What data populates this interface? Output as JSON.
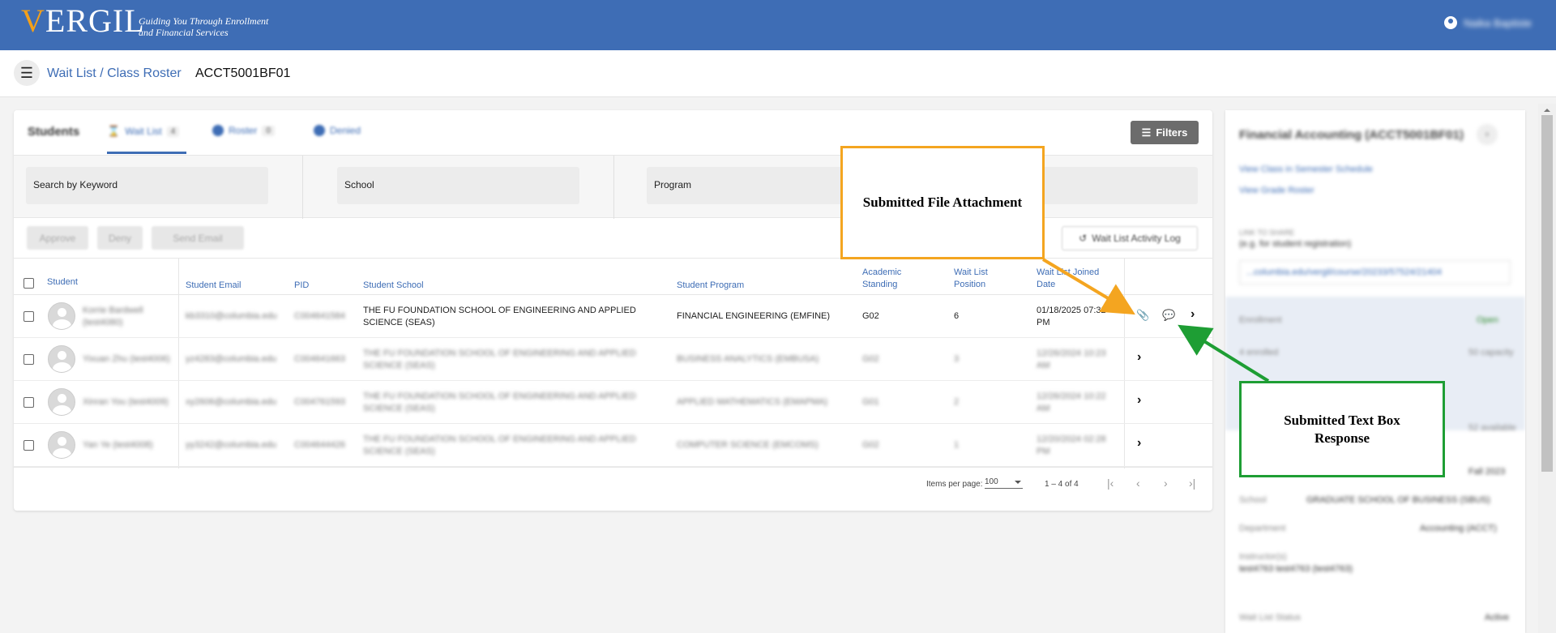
{
  "header": {
    "logo_text": "VERGIL",
    "tagline_line1": "Guiding You Through Enrollment",
    "tagline_line2": "and Financial Services",
    "user_name": "Naika Baptiste"
  },
  "breadcrumb": {
    "path": "Wait List / Class Roster",
    "course_code": "ACCT5001BF01"
  },
  "tabs": {
    "title": "Students",
    "items": [
      {
        "label": "Wait List",
        "count": "4"
      },
      {
        "label": "Roster",
        "count": "0"
      },
      {
        "label": "Denied",
        "count": ""
      }
    ],
    "filters_label": "Filters"
  },
  "search": {
    "keyword_placeholder": "Search by Keyword",
    "school_placeholder": "School",
    "program_placeholder": "Program"
  },
  "actions": {
    "approve": "Approve",
    "deny": "Deny",
    "send_email": "Send Email",
    "activity_log": "Wait List Activity Log"
  },
  "table": {
    "columns": {
      "student": "Student",
      "email": "Student Email",
      "pid": "PID",
      "school": "Student School",
      "program": "Student Program",
      "standing_1": "Academic",
      "standing_2": "Standing",
      "position_1": "Wait List",
      "position_2": "Position",
      "joined_1": "Wait List Joined",
      "joined_2": "Date"
    },
    "rows": [
      {
        "name_1": "Korrie Bardwell",
        "name_2": "(test4080)",
        "email": "kb3310@columbia.edu",
        "pid": "C004641584",
        "school_1": "THE FU FOUNDATION SCHOOL OF ENGINEERING AND APPLIED",
        "school_2": "SCIENCE (SEAS)",
        "program": "FINANCIAL ENGINEERING (EMFINE)",
        "standing": "G02",
        "position": "6",
        "joined_1": "01/18/2025 07:32",
        "joined_2": "PM"
      },
      {
        "name_1": "Yixuan Zhu (test4006)",
        "name_2": "",
        "email": "yz4283@columbia.edu",
        "pid": "C004641663",
        "school_1": "THE FU FOUNDATION SCHOOL OF ENGINEERING AND APPLIED",
        "school_2": "SCIENCE (SEAS)",
        "program": "BUSINESS ANALYTICS (EMBUSA)",
        "standing": "G02",
        "position": "3",
        "joined_1": "12/26/2024 10:23",
        "joined_2": "AM"
      },
      {
        "name_1": "Xinran You (test4009)",
        "name_2": "",
        "email": "xy2606@columbia.edu",
        "pid": "C004761593",
        "school_1": "THE FU FOUNDATION SCHOOL OF ENGINEERING AND APPLIED",
        "school_2": "SCIENCE (SEAS)",
        "program": "APPLIED MATHEMATICS (EMAPMA)",
        "standing": "G01",
        "position": "2",
        "joined_1": "12/26/2024 10:22",
        "joined_2": "AM"
      },
      {
        "name_1": "Yan Ye (test4008)",
        "name_2": "",
        "email": "yy3242@columbia.edu",
        "pid": "C004644426",
        "school_1": "THE FU FOUNDATION SCHOOL OF ENGINEERING AND APPLIED",
        "school_2": "SCIENCE (SEAS)",
        "program": "COMPUTER SCIENCE (EMCOMS)",
        "standing": "G02",
        "position": "1",
        "joined_1": "12/20/2024 02:28",
        "joined_2": "PM"
      }
    ]
  },
  "pager": {
    "items_per_page_label": "Items per page:",
    "items_per_page": "100",
    "range": "1 – 4 of 4"
  },
  "side_panel": {
    "course_title": "Financial Accounting (ACCT5001BF01)",
    "link_schedule": "View Class in Semester Schedule",
    "link_grade_roster": "View Grade Roster",
    "share_label": "LINK TO SHARE",
    "share_hint": "(e.g. for student registration)",
    "share_url": "...columbia.edu/vergil/course/20233/57524/21404",
    "enrollment_label": "Enrollment",
    "enrollment_status": "Open",
    "enrolled": "4 enrolled",
    "capacity": "50 capacity",
    "available": "52 available",
    "term": "Fall 2023",
    "school_label": "School",
    "school_value": "GRADUATE SCHOOL OF BUSINESS (SBUS)",
    "department_label": "Department",
    "department_value": "Accounting (ACCT)",
    "instructors_label": "Instructor(s)",
    "instructors_value": "test4763 test4763 (test4763)",
    "waitlist_status_label": "Wait List Status",
    "waitlist_status_value": "Active"
  },
  "annotations": {
    "file_attachment": "Submitted File Attachment",
    "text_box_line1": "Submitted Text Box",
    "text_box_line2": "Response",
    "orange": "#f4a520",
    "green": "#1e9e34"
  },
  "colors": {
    "brand_blue": "#3e6db5",
    "brand_orange": "#f4a019"
  }
}
